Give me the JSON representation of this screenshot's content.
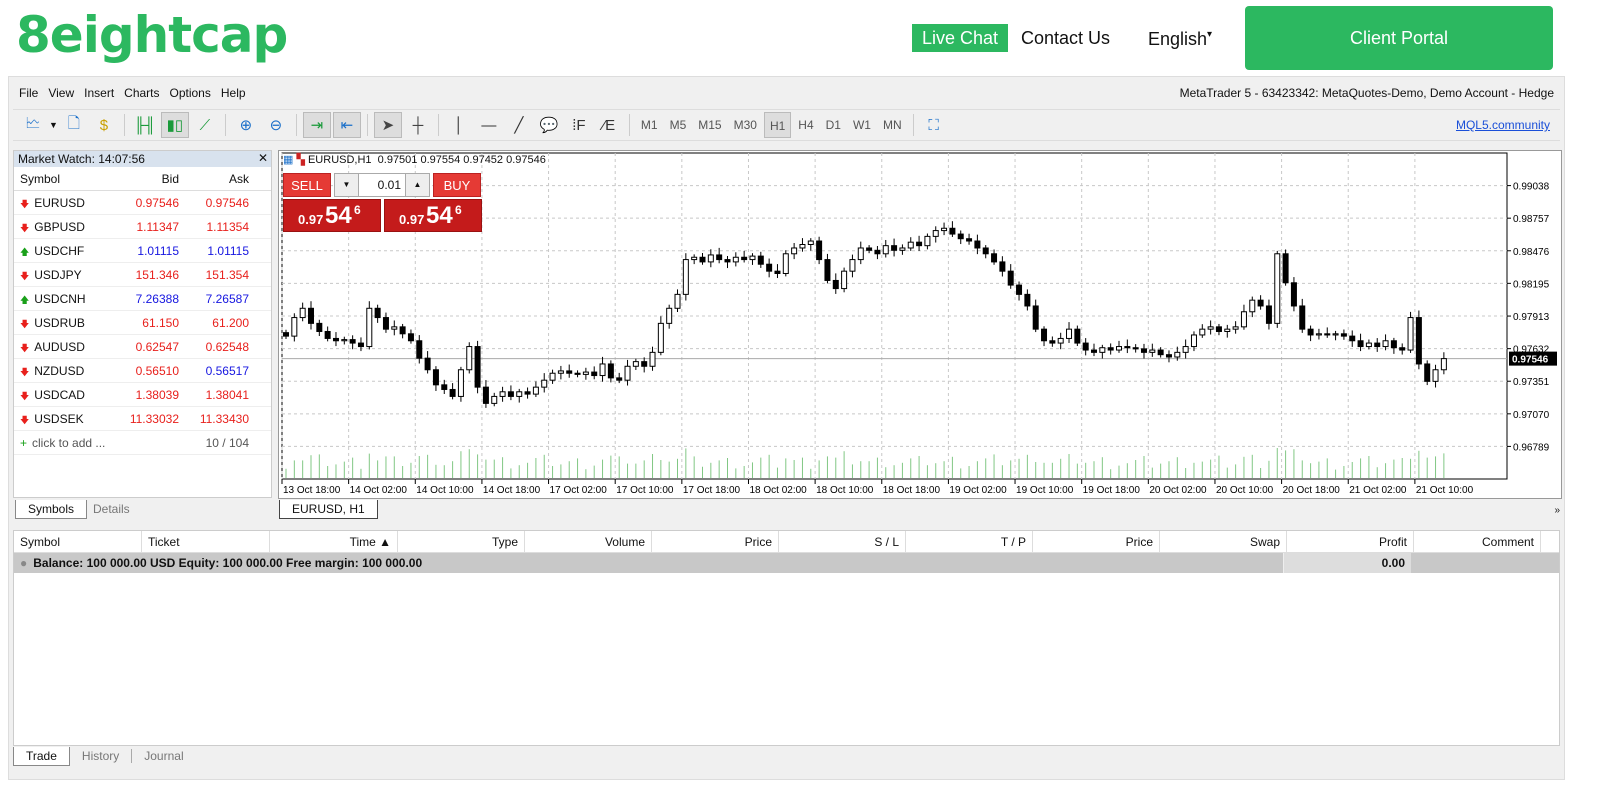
{
  "header": {
    "logo": "8eightcap",
    "live_chat": "Live Chat",
    "contact": "Contact Us",
    "language": "English",
    "client_portal": "Client Portal"
  },
  "menu": [
    "File",
    "View",
    "Insert",
    "Charts",
    "Options",
    "Help"
  ],
  "account": "MetaTrader 5 - 63423342: MetaQuotes-Demo, Demo Account - Hedge",
  "timeframes": [
    "M1",
    "M5",
    "M15",
    "M30",
    "H1",
    "H4",
    "D1",
    "W1",
    "MN"
  ],
  "active_timeframe": "H1",
  "mql5": "MQL5.community",
  "market_watch": {
    "title": "Market Watch: 14:07:56",
    "cols": [
      "Symbol",
      "Bid",
      "Ask"
    ],
    "rows": [
      {
        "s": "EURUSD",
        "b": "0.97546",
        "a": "0.97546",
        "dir": "down",
        "c": "red",
        "ac": "red"
      },
      {
        "s": "GBPUSD",
        "b": "1.11347",
        "a": "1.11354",
        "dir": "down",
        "c": "red",
        "ac": "red"
      },
      {
        "s": "USDCHF",
        "b": "1.01115",
        "a": "1.01115",
        "dir": "up",
        "c": "blue",
        "ac": "blue"
      },
      {
        "s": "USDJPY",
        "b": "151.346",
        "a": "151.354",
        "dir": "down",
        "c": "red",
        "ac": "red"
      },
      {
        "s": "USDCNH",
        "b": "7.26388",
        "a": "7.26587",
        "dir": "up",
        "c": "blue",
        "ac": "blue"
      },
      {
        "s": "USDRUB",
        "b": "61.150",
        "a": "61.200",
        "dir": "down",
        "c": "red",
        "ac": "red"
      },
      {
        "s": "AUDUSD",
        "b": "0.62547",
        "a": "0.62548",
        "dir": "down",
        "c": "red",
        "ac": "red"
      },
      {
        "s": "NZDUSD",
        "b": "0.56510",
        "a": "0.56517",
        "dir": "down",
        "c": "red",
        "ac": "blue"
      },
      {
        "s": "USDCAD",
        "b": "1.38039",
        "a": "1.38041",
        "dir": "down",
        "c": "red",
        "ac": "red"
      },
      {
        "s": "USDSEK",
        "b": "11.33032",
        "a": "11.33430",
        "dir": "down",
        "c": "red",
        "ac": "red"
      }
    ],
    "add": "click to add ...",
    "count": "10 / 104",
    "tabs": [
      "Symbols",
      "Details"
    ]
  },
  "chart": {
    "header": "EURUSD,H1  0.97501 0.97554 0.97452 0.97546",
    "tab": "EURUSD, H1",
    "sell": "SELL",
    "buy": "BUY",
    "lot": "0.01",
    "price_small": "0.97",
    "price_big": "54",
    "price_sup": "6"
  },
  "chart_data": {
    "type": "candlestick",
    "symbol": "EURUSD",
    "timeframe": "H1",
    "ylim": [
      0.96508,
      0.99319
    ],
    "yticks": [
      "0.99038",
      "0.98757",
      "0.98476",
      "0.98195",
      "0.97913",
      "0.97632",
      "0.97351",
      "0.97070",
      "0.96789"
    ],
    "xticks": [
      "13 Oct 18:00",
      "14 Oct 02:00",
      "14 Oct 10:00",
      "14 Oct 18:00",
      "17 Oct 02:00",
      "17 Oct 10:00",
      "17 Oct 18:00",
      "18 Oct 02:00",
      "18 Oct 10:00",
      "18 Oct 18:00",
      "19 Oct 02:00",
      "19 Oct 10:00",
      "19 Oct 18:00",
      "20 Oct 02:00",
      "20 Oct 10:00",
      "20 Oct 18:00",
      "21 Oct 02:00",
      "21 Oct 10:00"
    ],
    "current_price": "0.97546",
    "closes": [
      0.9774,
      0.979,
      0.9798,
      0.9785,
      0.9778,
      0.9772,
      0.977,
      0.9771,
      0.9768,
      0.9765,
      0.9798,
      0.979,
      0.978,
      0.9782,
      0.9776,
      0.977,
      0.9755,
      0.9745,
      0.9732,
      0.9728,
      0.9722,
      0.9745,
      0.9765,
      0.973,
      0.9716,
      0.9722,
      0.9726,
      0.9722,
      0.9726,
      0.9724,
      0.973,
      0.9736,
      0.9742,
      0.9744,
      0.9742,
      0.9741,
      0.9743,
      0.974,
      0.975,
      0.9738,
      0.9736,
      0.9748,
      0.9752,
      0.9748,
      0.976,
      0.9785,
      0.9798,
      0.981,
      0.984,
      0.9842,
      0.9838,
      0.9844,
      0.984,
      0.9838,
      0.9842,
      0.984,
      0.9843,
      0.9836,
      0.983,
      0.9828,
      0.9845,
      0.985,
      0.9853,
      0.9856,
      0.984,
      0.9822,
      0.9815,
      0.983,
      0.984,
      0.985,
      0.9848,
      0.9845,
      0.9852,
      0.9848,
      0.985,
      0.9855,
      0.9852,
      0.986,
      0.9865,
      0.9867,
      0.9862,
      0.9858,
      0.9856,
      0.985,
      0.9845,
      0.9838,
      0.983,
      0.9818,
      0.981,
      0.98,
      0.978,
      0.977,
      0.9768,
      0.9772,
      0.978,
      0.9768,
      0.9762,
      0.976,
      0.9764,
      0.9762,
      0.9765,
      0.9764,
      0.9763,
      0.976,
      0.9762,
      0.9758,
      0.9756,
      0.976,
      0.9765,
      0.9775,
      0.978,
      0.9782,
      0.9778,
      0.978,
      0.9782,
      0.9795,
      0.9805,
      0.98,
      0.9785,
      0.9845,
      0.982,
      0.98,
      0.978,
      0.9775,
      0.9776,
      0.9775,
      0.9776,
      0.9774,
      0.977,
      0.9765,
      0.9768,
      0.9765,
      0.977,
      0.9764,
      0.9762,
      0.979,
      0.975,
      0.9735,
      0.9745,
      0.97546
    ]
  },
  "terminal": {
    "cols": [
      "Symbol",
      "Ticket",
      "Time ▲",
      "Type",
      "Volume",
      "Price",
      "S / L",
      "T / P",
      "Price",
      "Swap",
      "Profit",
      "Comment"
    ],
    "balance": "Balance: 100 000.00 USD  Equity: 100 000.00  Free margin: 100 000.00",
    "profit": "0.00",
    "tabs": [
      "Trade",
      "History",
      "Journal"
    ]
  },
  "colors": {
    "brand": "#2cb860",
    "sell": "#e53a35",
    "bid_down": "#e8201c",
    "bid_up": "#1616e0"
  }
}
